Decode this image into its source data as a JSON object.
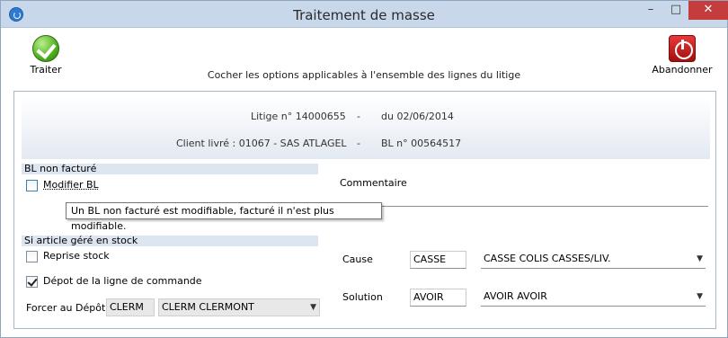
{
  "window": {
    "title": "Traitement de masse",
    "minimize": "–",
    "maximize": "□",
    "close": "✕"
  },
  "toolbar": {
    "traiter_label": "Traiter",
    "abandonner_label": "Abandonner"
  },
  "instruction": "Cocher les options applicables à l'ensemble des lignes du litige",
  "header": {
    "litige": "Litige n° 14000655",
    "dash1": "-",
    "date": "du 02/06/2014",
    "client": "Client livré : 01067 - SAS ATLAGEL",
    "dash2": "-",
    "bl": "BL n° 00564517"
  },
  "bl_section": {
    "title": "BL non  facturé",
    "modifier_bl_label": "Modifier BL",
    "modifier_bl_checked": false,
    "tooltip": "Un BL non facturé est modifiable, facturé il n'est plus modifiable."
  },
  "stock_section": {
    "title": "Si article géré en stock",
    "reprise_label": "Reprise stock",
    "reprise_checked": false,
    "depot_label": "Dépot de la ligne de commande",
    "depot_checked": true,
    "forcer_label": "Forcer au Dépôt",
    "depot_code": "CLERM",
    "depot_name": "CLERM CLERMONT"
  },
  "commentaire": {
    "label": "Commentaire",
    "value": ""
  },
  "cause": {
    "label": "Cause",
    "code": "CASSE",
    "description": "CASSE COLIS CASSES/LIV."
  },
  "solution": {
    "label": "Solution",
    "code": "AVOIR",
    "description": "AVOIR AVOIR"
  },
  "icons": {
    "app": "app-icon",
    "traiter": "check-icon",
    "abandonner": "power-stop-icon",
    "dropdown": "chevron-down-icon",
    "dropdown_glyph": "▼"
  }
}
